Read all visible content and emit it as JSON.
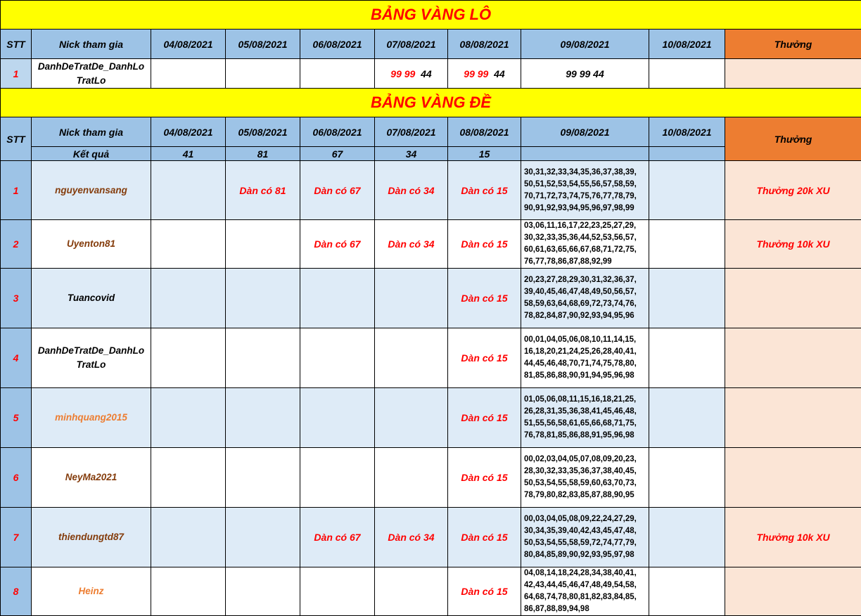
{
  "lo": {
    "title": "BẢNG VÀNG LÔ",
    "headers": [
      "STT",
      "Nick tham gia",
      "04/08/2021",
      "05/08/2021",
      "06/08/2021",
      "07/08/2021",
      "08/08/2021",
      "09/08/2021",
      "10/08/2021",
      "Thưởng"
    ],
    "row": {
      "stt": "1",
      "nick": "DanhDeTratDe_DanhLo TratLo",
      "d07_red": "99 99",
      "d07_black": "44",
      "d08_red": "99 99",
      "d08_black": "44",
      "d09": "99 99 44"
    }
  },
  "de": {
    "title": "BẢNG VÀNG ĐỀ",
    "headers": [
      "STT",
      "Nick tham gia",
      "04/08/2021",
      "05/08/2021",
      "06/08/2021",
      "07/08/2021",
      "08/08/2021",
      "09/08/2021",
      "10/08/2021",
      "Thưởng"
    ],
    "ket_qua_label": "Kết quả",
    "ket_qua": [
      "41",
      "81",
      "67",
      "34",
      "15"
    ],
    "rows": [
      {
        "stt": "1",
        "nick": "nguyenvansang",
        "d05": "Dàn có 81",
        "d06": "Dàn có 67",
        "d07": "Dàn có 34",
        "d08": "Dàn có 15",
        "d09": "30,31,32,33,34,35,36,37,38,39, 50,51,52,53,54,55,56,57,58,59, 70,71,72,73,74,75,76,77,78,79, 90,91,92,93,94,95,96,97,98,99",
        "thuong": "Thưởng 20k XU"
      },
      {
        "stt": "2",
        "nick": "Uyenton81",
        "d05": "",
        "d06": "Dàn có 67",
        "d07": "Dàn có 34",
        "d08": "Dàn có 15",
        "d09": "03,06,11,16,17,22,23,25,27,29, 30,32,33,35,36,44,52,53,56,57, 60,61,63,65,66,67,68,71,72,75, 76,77,78,86,87,88,92,99",
        "thuong": "Thưởng 10k XU"
      },
      {
        "stt": "3",
        "nick": "Tuancovid",
        "d05": "",
        "d06": "",
        "d07": "",
        "d08": "Dàn có 15",
        "d09": "20,23,27,28,29,30,31,32,36,37, 39,40,45,46,47,48,49,50,56,57, 58,59,63,64,68,69,72,73,74,76, 78,82,84,87,90,92,93,94,95,96",
        "thuong": ""
      },
      {
        "stt": "4",
        "nick": "DanhDeTratDe_DanhLo TratLo",
        "d05": "",
        "d06": "",
        "d07": "",
        "d08": "Dàn có 15",
        "d09": "00,01,04,05,06,08,10,11,14,15, 16,18,20,21,24,25,26,28,40,41, 44,45,46,48,70,71,74,75,78,80, 81,85,86,88,90,91,94,95,96,98",
        "thuong": ""
      },
      {
        "stt": "5",
        "nick": "minhquang2015",
        "d05": "",
        "d06": "",
        "d07": "",
        "d08": "Dàn có 15",
        "d09": "01,05,06,08,11,15,16,18,21,25, 26,28,31,35,36,38,41,45,46,48, 51,55,56,58,61,65,66,68,71,75, 76,78,81,85,86,88,91,95,96,98",
        "thuong": ""
      },
      {
        "stt": "6",
        "nick": "NeyMa2021",
        "d05": "",
        "d06": "",
        "d07": "",
        "d08": "Dàn có 15",
        "d09": "00,02,03,04,05,07,08,09,20,23, 28,30,32,33,35,36,37,38,40,45, 50,53,54,55,58,59,60,63,70,73, 78,79,80,82,83,85,87,88,90,95",
        "thuong": ""
      },
      {
        "stt": "7",
        "nick": "thiendungtd87",
        "d05": "",
        "d06": "Dàn có 67",
        "d07": "Dàn có 34",
        "d08": "Dàn có 15",
        "d09": "00,03,04,05,08,09,22,24,27,29, 30,34,35,39,40,42,43,45,47,48, 50,53,54,55,58,59,72,74,77,79, 80,84,85,89,90,92,93,95,97,98",
        "thuong": "Thưởng 10k XU"
      },
      {
        "stt": "8",
        "nick": "Heinz",
        "d05": "",
        "d06": "",
        "d07": "",
        "d08": "Dàn có 15",
        "d09": "04,08,14,18,24,28,34,38,40,41, 42,43,44,45,46,47,48,49,54,58, 64,68,74,78,80,81,82,83,84,85, 86,87,88,89,94,98",
        "thuong": ""
      }
    ]
  },
  "colors": {
    "title_bg": "#ffff00",
    "title_text": "#ff0000",
    "header_bg": "#9dc3e6",
    "reward_header_bg": "#ed7d31",
    "reward_cell_bg": "#fbe5d6",
    "row_shade": "#deebf7"
  }
}
